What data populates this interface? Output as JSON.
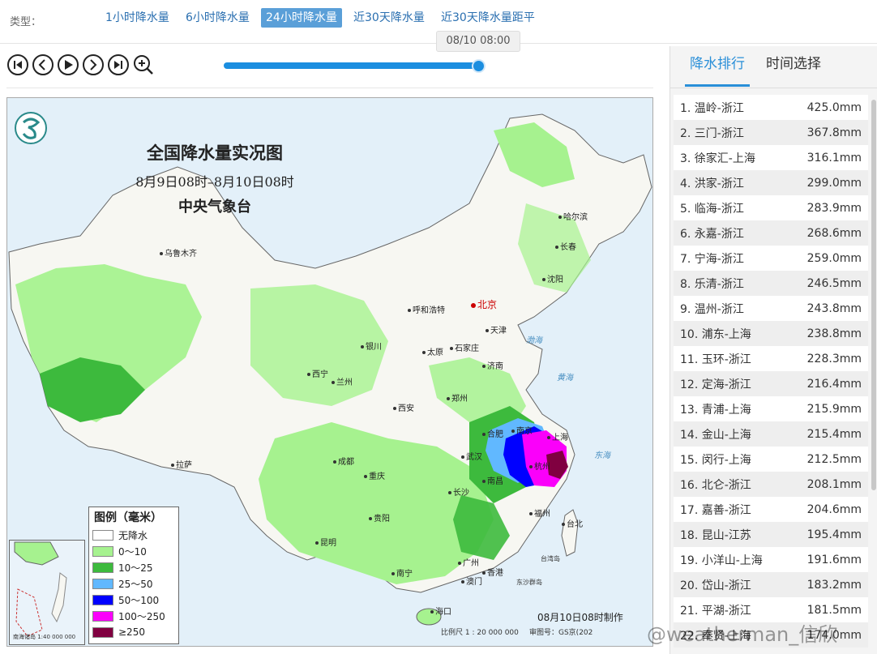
{
  "header": {
    "type_label": "类型：",
    "tabs": [
      "1小时降水量",
      "6小时降水量",
      "24小时降水量",
      "近30天降水量",
      "近30天降水量距平"
    ],
    "active_tab": "24小时降水量"
  },
  "player": {
    "current_time": "08/10 08:00",
    "progress": 1.0
  },
  "map": {
    "title": "全国降水量实况图",
    "subtitle": "8月9日08时–8月10日08时",
    "organization": "中央气象台",
    "produced": "08月10日08时制作",
    "scale": "比例尺 1 : 20 000 000",
    "review_no": "审图号：GS京(202",
    "cities": [
      "乌鲁木齐",
      "哈尔滨",
      "长春",
      "沈阳",
      "呼和浩特",
      "北京",
      "天津",
      "银川",
      "太原",
      "石家庄",
      "济南",
      "西宁",
      "兰州",
      "西安",
      "郑州",
      "合肥",
      "南京",
      "上海",
      "武汉",
      "成都",
      "重庆",
      "拉萨",
      "长沙",
      "南昌",
      "杭州",
      "福州",
      "贵阳",
      "昆明",
      "南宁",
      "广州",
      "香港",
      "澳门",
      "台北",
      "海口"
    ],
    "seas": [
      "渤海",
      "黄海",
      "东海",
      "台湾岛",
      "东沙群岛"
    ],
    "legend": {
      "title": "图例（毫米）",
      "items": [
        {
          "label": "无降水",
          "color": "#ffffff"
        },
        {
          "label": "0～10",
          "color": "#a6f28f"
        },
        {
          "label": "10～25",
          "color": "#3dba3d"
        },
        {
          "label": "25～50",
          "color": "#61b8ff"
        },
        {
          "label": "50～100",
          "color": "#0000ff"
        },
        {
          "label": "100～250",
          "color": "#fa00fa"
        },
        {
          "label": "≥250",
          "color": "#800040"
        }
      ]
    },
    "inset_label": "南海诸岛 1:40 000 000"
  },
  "watermark": "@weatherman_信欣",
  "panel": {
    "tabs": [
      "降水排行",
      "时间选择"
    ],
    "active_tab": "降水排行",
    "ranking": [
      {
        "name": "1. 温岭-浙江",
        "value": "425.0mm"
      },
      {
        "name": "2. 三门-浙江",
        "value": "367.8mm"
      },
      {
        "name": "3. 徐家汇-上海",
        "value": "316.1mm"
      },
      {
        "name": "4. 洪家-浙江",
        "value": "299.0mm"
      },
      {
        "name": "5. 临海-浙江",
        "value": "283.9mm"
      },
      {
        "name": "6. 永嘉-浙江",
        "value": "268.6mm"
      },
      {
        "name": "7. 宁海-浙江",
        "value": "259.0mm"
      },
      {
        "name": "8. 乐清-浙江",
        "value": "246.5mm"
      },
      {
        "name": "9. 温州-浙江",
        "value": "243.8mm"
      },
      {
        "name": "10. 浦东-上海",
        "value": "238.8mm"
      },
      {
        "name": "11. 玉环-浙江",
        "value": "228.3mm"
      },
      {
        "name": "12. 定海-浙江",
        "value": "216.4mm"
      },
      {
        "name": "13. 青浦-上海",
        "value": "215.9mm"
      },
      {
        "name": "14. 金山-上海",
        "value": "215.4mm"
      },
      {
        "name": "15. 闵行-上海",
        "value": "212.5mm"
      },
      {
        "name": "16. 北仑-浙江",
        "value": "208.1mm"
      },
      {
        "name": "17. 嘉善-浙江",
        "value": "204.6mm"
      },
      {
        "name": "18. 昆山-江苏",
        "value": "195.4mm"
      },
      {
        "name": "19. 小洋山-上海",
        "value": "191.6mm"
      },
      {
        "name": "20. 岱山-浙江",
        "value": "183.2mm"
      },
      {
        "name": "21. 平湖-浙江",
        "value": "181.5mm"
      },
      {
        "name": "22. 奉贤-上海",
        "value": "174.0mm"
      }
    ]
  },
  "colors": {
    "accent": "#2a8fd8",
    "slider": "#1b8ee0"
  }
}
